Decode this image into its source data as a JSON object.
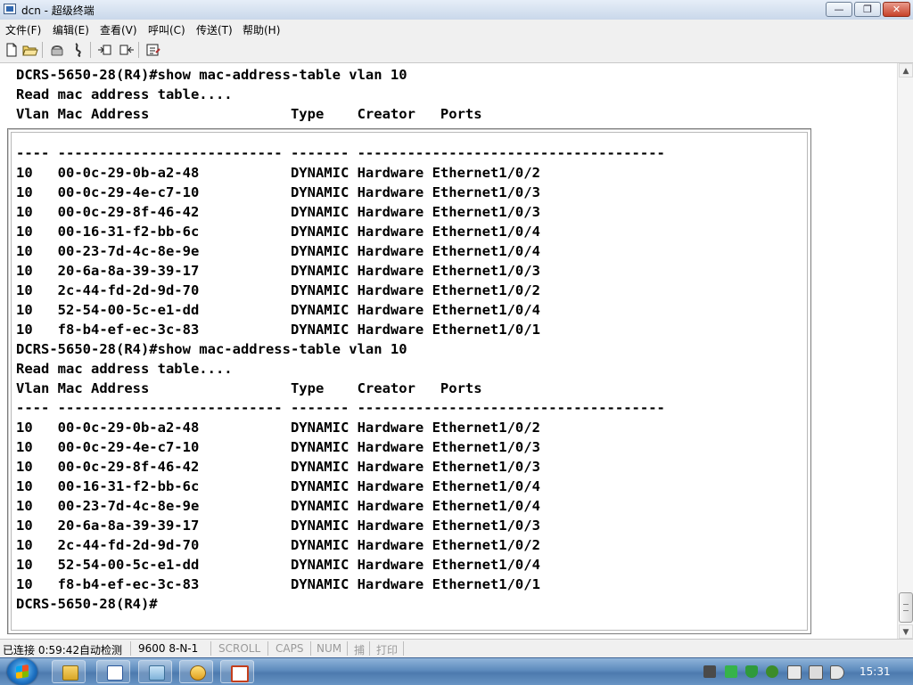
{
  "window": {
    "title": "dcn - 超级终端"
  },
  "menu": [
    "文件(F)",
    "编辑(E)",
    "查看(V)",
    "呼叫(C)",
    "传送(T)",
    "帮助(H)"
  ],
  "toolbar": [
    "new-icon",
    "open-icon",
    "dial-icon",
    "disconnect-icon",
    "send-icon",
    "receive-icon",
    "properties-icon"
  ],
  "terminal": {
    "lines": [
      "DCRS-5650-28(R4)#show mac-address-table vlan 10",
      "Read mac address table....",
      "Vlan Mac Address                 Type    Creator   Ports",
      "",
      "---- --------------------------- ------- -------------------------------------",
      "10   00-0c-29-0b-a2-48           DYNAMIC Hardware Ethernet1/0/2",
      "10   00-0c-29-4e-c7-10           DYNAMIC Hardware Ethernet1/0/3",
      "10   00-0c-29-8f-46-42           DYNAMIC Hardware Ethernet1/0/3",
      "10   00-16-31-f2-bb-6c           DYNAMIC Hardware Ethernet1/0/4",
      "10   00-23-7d-4c-8e-9e           DYNAMIC Hardware Ethernet1/0/4",
      "10   20-6a-8a-39-39-17           DYNAMIC Hardware Ethernet1/0/3",
      "10   2c-44-fd-2d-9d-70           DYNAMIC Hardware Ethernet1/0/2",
      "10   52-54-00-5c-e1-dd           DYNAMIC Hardware Ethernet1/0/4",
      "10   f8-b4-ef-ec-3c-83           DYNAMIC Hardware Ethernet1/0/1",
      "DCRS-5650-28(R4)#show mac-address-table vlan 10",
      "Read mac address table....",
      "Vlan Mac Address                 Type    Creator   Ports",
      "---- --------------------------- ------- -------------------------------------",
      "10   00-0c-29-0b-a2-48           DYNAMIC Hardware Ethernet1/0/2",
      "10   00-0c-29-4e-c7-10           DYNAMIC Hardware Ethernet1/0/3",
      "10   00-0c-29-8f-46-42           DYNAMIC Hardware Ethernet1/0/3",
      "10   00-16-31-f2-bb-6c           DYNAMIC Hardware Ethernet1/0/4",
      "10   00-23-7d-4c-8e-9e           DYNAMIC Hardware Ethernet1/0/4",
      "10   20-6a-8a-39-39-17           DYNAMIC Hardware Ethernet1/0/3",
      "10   2c-44-fd-2d-9d-70           DYNAMIC Hardware Ethernet1/0/2",
      "10   52-54-00-5c-e1-dd           DYNAMIC Hardware Ethernet1/0/4",
      "10   f8-b4-ef-ec-3c-83           DYNAMIC Hardware Ethernet1/0/1",
      "DCRS-5650-28(R4)#"
    ]
  },
  "status": {
    "connection": "已连接 0:59:42",
    "detect": "自动检测",
    "baud": "9600 8-N-1",
    "scroll": "SCROLL",
    "caps": "CAPS",
    "num": "NUM",
    "capture": "捕",
    "print": "打印"
  },
  "taskbar": {
    "apps": [
      "explorer-icon",
      "word-icon",
      "folder-icon",
      "network-app-icon",
      "powerpoint-icon"
    ],
    "tray": [
      "flag-icon",
      "battery-icon",
      "shield-icon",
      "security-icon",
      "clipboard-icon",
      "pen-icon",
      "monitor-icon",
      "speaker-icon"
    ],
    "clock": "15:31"
  },
  "colors": {
    "terminal_bg": "#ffffff",
    "terminal_text": "#000000",
    "taskbar": "#5d8bbd"
  }
}
